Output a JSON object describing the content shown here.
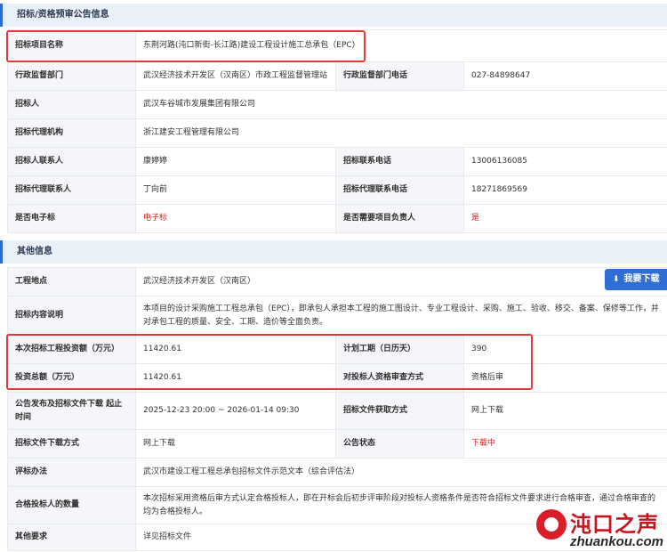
{
  "section1": {
    "title": "招标/资格预审公告信息",
    "project_name": {
      "label": "招标项目名称",
      "value": "东荆河路(沌口新街-长江路)建设工程设计施工总承包（EPC）"
    },
    "supervisor": {
      "label": "行政监督部门",
      "value": "武汉经济技术开发区（汉南区）市政工程监督管理站"
    },
    "supervisor_phone": {
      "label": "行政监督部门电话",
      "value": "027-84898647"
    },
    "tenderer": {
      "label": "招标人",
      "value": "武汉车谷城市发展集团有限公司"
    },
    "agency": {
      "label": "招标代理机构",
      "value": "浙江建安工程管理有限公司"
    },
    "tenderer_contact": {
      "label": "招标人联系人",
      "value": "康婷婷"
    },
    "tender_phone": {
      "label": "招标联系电话",
      "value": "13006136085"
    },
    "agency_contact": {
      "label": "招标代理联系人",
      "value": "丁向前"
    },
    "agency_phone": {
      "label": "招标代理联系电话",
      "value": "18271869569"
    },
    "e_bid": {
      "label": "是否电子标",
      "value": "电子标"
    },
    "need_leader": {
      "label": "是否需要项目负责人",
      "value": "是"
    }
  },
  "section2": {
    "title": "其他信息",
    "location": {
      "label": "工程地点",
      "value": "武汉经济技术开发区（汉南区）"
    },
    "scope": {
      "label": "招标内容说明",
      "value": "本项目的设计采购施工工程总承包（EPC），即承包人承担本工程的施工图设计、专业工程设计、采购、施工、验收、移交、备案、保修等工作，并对承包工程的质量、安全、工期、造价等全面负责。"
    },
    "invest_amount": {
      "label": "本次招标工程投资额（万元）",
      "value": "11420.61"
    },
    "duration": {
      "label": "计划工期（日历天）",
      "value": "390"
    },
    "total_invest": {
      "label": "投资总额（万元）",
      "value": "11420.61"
    },
    "review_method": {
      "label": "对投标人资格审查方式",
      "value": "资格后审"
    },
    "publish_time": {
      "label": "公告发布及招标文件下载 起止时间",
      "value": "2025-12-23 20:00 ~ 2026-01-14 09:30"
    },
    "doc_access": {
      "label": "招标文件获取方式",
      "value": "网上下载"
    },
    "download_method": {
      "label": "招标文件下载方式",
      "value": "网上下载"
    },
    "notice_status": {
      "label": "公告状态",
      "value": "下载中"
    },
    "evaluation": {
      "label": "评标办法",
      "value": "武汉市建设工程工程总承包招标文件示范文本（综合评估法）"
    },
    "qualified_count": {
      "label": "合格投标人的数量",
      "value": "本次招标采用资格后审方式认定合格投标人，即在开标会后初步评审阶段对投标人资格条件是否符合招标文件要求进行合格审查，通过合格审查的均为合格投标人。"
    },
    "other": {
      "label": "其他要求",
      "value": "详见招标文件"
    }
  },
  "download_button": {
    "label": "我要下载",
    "icon": "download-icon"
  },
  "watermark": {
    "name": "沌口之声",
    "url": "zhuankou.com"
  },
  "colors": {
    "accent": "#2f6fd5",
    "highlight": "#e5383b",
    "alert_text": "#e01b1b",
    "label_bg": "#f5f6f9"
  }
}
